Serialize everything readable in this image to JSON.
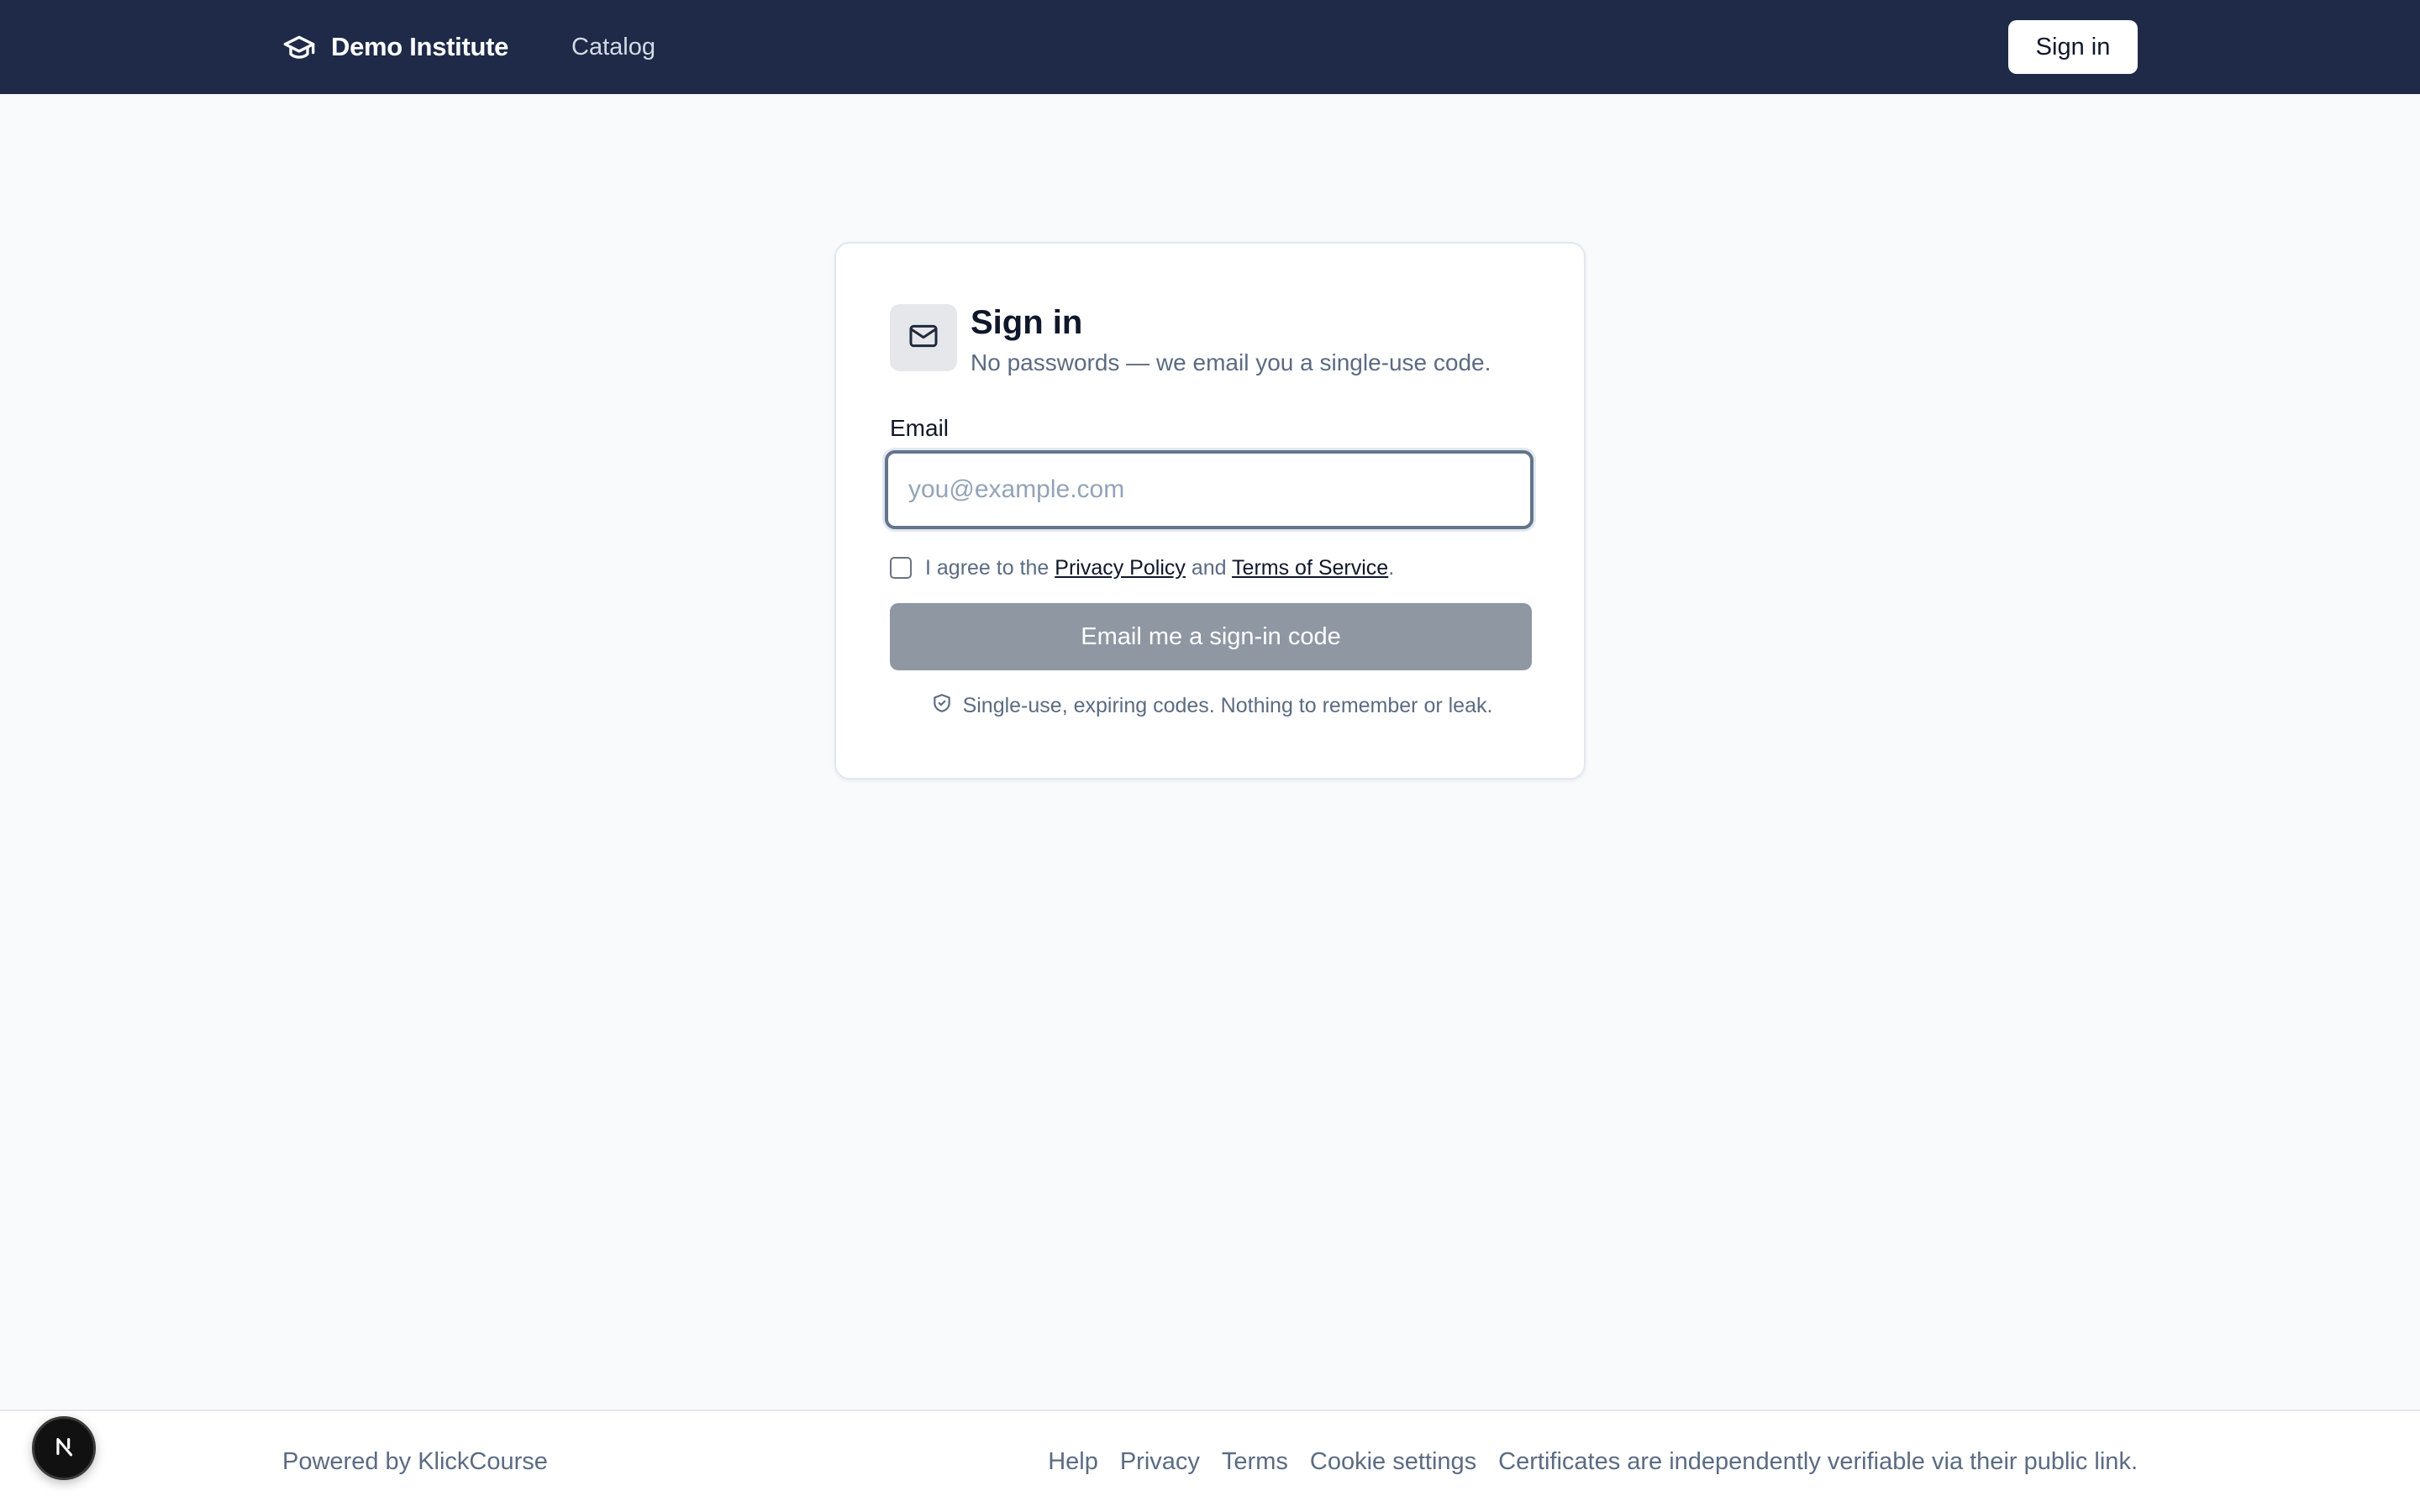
{
  "header": {
    "brand_name": "Demo Institute",
    "brand_icon": "graduation-cap-icon",
    "nav_catalog": "Catalog",
    "signin_label": "Sign in"
  },
  "signin_card": {
    "icon": "mail-icon",
    "title": "Sign in",
    "subtitle": "No passwords — we email you a single-use code.",
    "email_label": "Email",
    "email_value": "",
    "email_placeholder": "you@example.com",
    "agree_prefix": "I agree to the",
    "privacy_link": "Privacy Policy",
    "agree_and": "and",
    "terms_link": "Terms of Service",
    "agree_suffix": ".",
    "agree_checked": false,
    "submit_label": "Email me a sign-in code",
    "note_icon": "shield-check-icon",
    "note_text": "Single-use, expiring codes. Nothing to remember or leak."
  },
  "footer": {
    "powered_by": "Powered by KlickCourse",
    "links": [
      "Help",
      "Privacy",
      "Terms",
      "Cookie settings"
    ],
    "certificates_note": "Certificates are independently verifiable via their public link."
  },
  "dev_badge": {
    "letter": "N",
    "icon": "nextjs-icon"
  },
  "colors": {
    "header_bg": "#1e2a47",
    "page_bg": "#f8fafc",
    "button_disabled_bg": "#8f97a3",
    "text_primary": "#0f172a",
    "text_muted": "#5b6b82"
  }
}
